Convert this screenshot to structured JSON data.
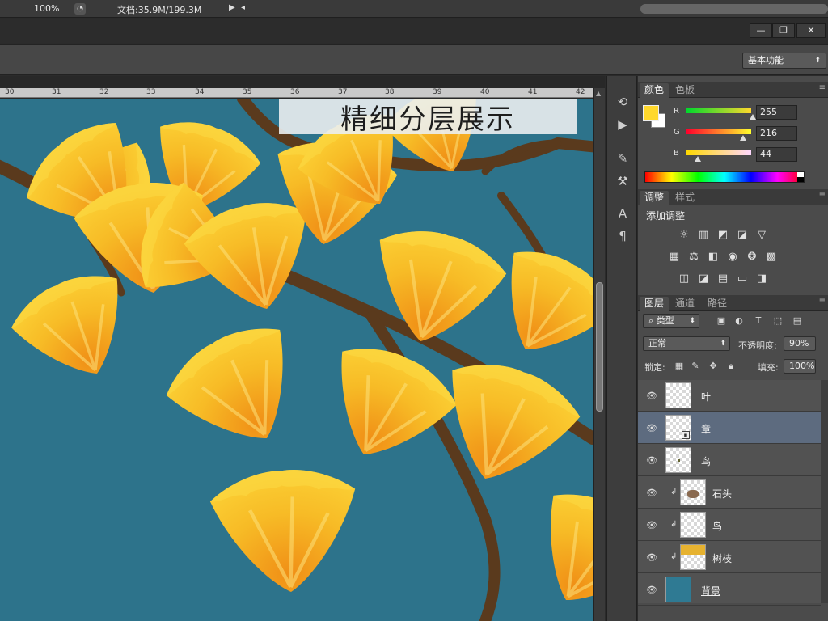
{
  "status": {
    "zoom": "100%",
    "doc_info": "文档:35.9M/199.3M"
  },
  "window": {
    "minimize": "—",
    "restore": "❐",
    "close": "✕"
  },
  "options": {
    "workspace": "基本功能"
  },
  "canvas": {
    "ruler_ticks": [
      "30",
      "31",
      "32",
      "33",
      "34",
      "35",
      "36",
      "37",
      "38",
      "39",
      "40",
      "41",
      "42"
    ],
    "banner_text": "精细分层展示"
  },
  "tools": [
    "history-icon",
    "play-icon",
    "brush-settings-icon",
    "tool-preset-icon",
    "character-icon",
    "paragraph-icon"
  ],
  "color_panel": {
    "tabs": [
      "颜色",
      "色板"
    ],
    "foreground": "#ffd82c",
    "channels": [
      {
        "label": "R",
        "value": "255",
        "fraction": 1.0
      },
      {
        "label": "G",
        "value": "216",
        "fraction": 0.847
      },
      {
        "label": "B",
        "value": "44",
        "fraction": 0.173
      }
    ]
  },
  "adjust_panel": {
    "tabs": [
      "调整",
      "样式"
    ],
    "title": "添加调整",
    "rows": [
      [
        "brightness-icon",
        "levels-icon",
        "curves-icon",
        "exposure-icon",
        "vibrance-icon"
      ],
      [
        "hue-icon",
        "balance-icon",
        "black-white-icon",
        "photo-filter-icon",
        "mixer-icon",
        "lookup-icon"
      ],
      [
        "invert-icon",
        "posterize-icon",
        "threshold-icon",
        "gradient-map-icon",
        "selective-color-icon"
      ]
    ]
  },
  "layers_panel": {
    "tabs": [
      "图层",
      "通道",
      "路径"
    ],
    "filter_kind": "类型",
    "blend_mode": "正常",
    "opacity_label": "不透明度:",
    "opacity": "90%",
    "lock_label": "锁定:",
    "fill_label": "填充:",
    "fill": "100%",
    "layers": [
      {
        "name": "叶",
        "clipped": false,
        "selected": false,
        "thumb": "transparent"
      },
      {
        "name": "章",
        "clipped": false,
        "selected": true,
        "thumb": "smart"
      },
      {
        "name": "鸟",
        "clipped": false,
        "selected": false,
        "thumb": "dot"
      },
      {
        "name": "石头",
        "clipped": true,
        "selected": false,
        "thumb": "stones"
      },
      {
        "name": "鸟",
        "clipped": true,
        "selected": false,
        "thumb": "transparent"
      },
      {
        "name": "树枝",
        "clipped": true,
        "selected": false,
        "thumb": "leaves"
      },
      {
        "name": "背景",
        "clipped": false,
        "selected": false,
        "thumb": "blue"
      }
    ]
  }
}
